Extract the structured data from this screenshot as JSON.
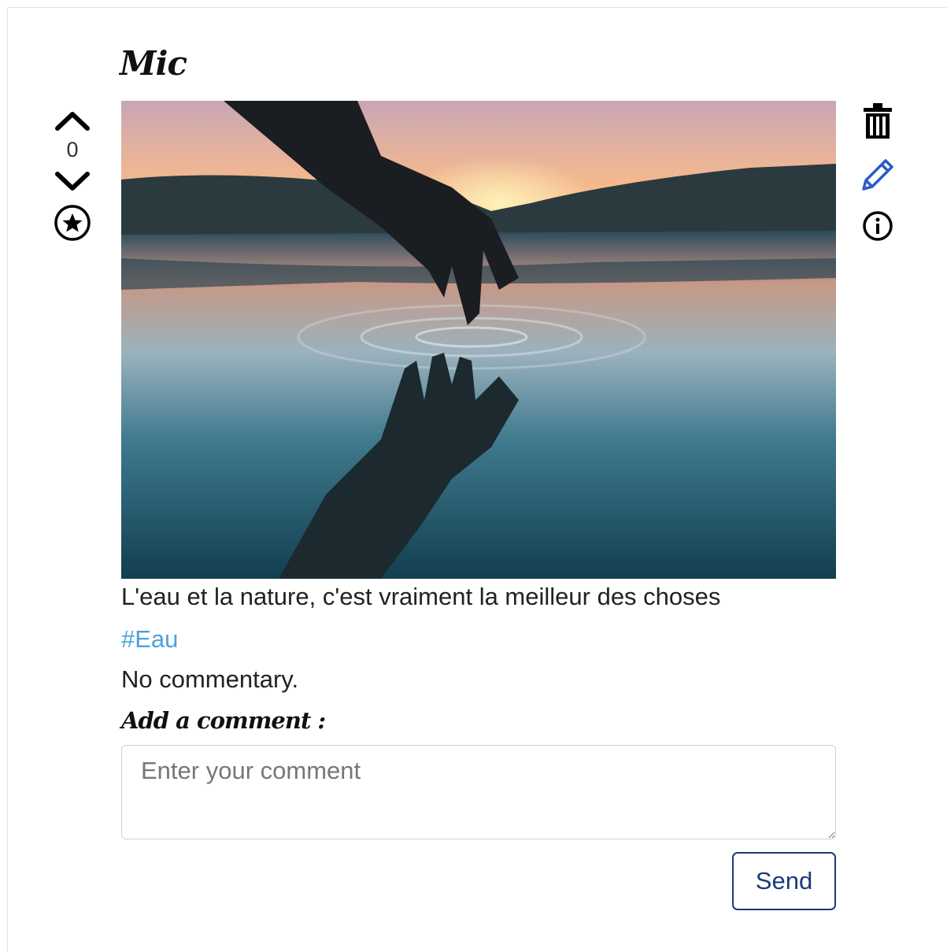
{
  "post": {
    "author": "Mic",
    "votes": "0",
    "caption": "L'eau et la nature, c'est vraiment la meilleur des choses",
    "hashtag": "#Eau",
    "comments_empty": "No commentary.",
    "add_comment_label": "Add a comment :",
    "comment_placeholder": "Enter your comment",
    "send_label": "Send"
  },
  "icons": {
    "upvote": "chevron-up-icon",
    "downvote": "chevron-down-icon",
    "favorite": "star-circle-icon",
    "delete": "trash-icon",
    "edit": "pencil-icon",
    "info": "info-icon"
  },
  "colors": {
    "hashtag": "#4aa3df",
    "edit_icon": "#2a5cc4",
    "send_border": "#1a3a7a"
  }
}
